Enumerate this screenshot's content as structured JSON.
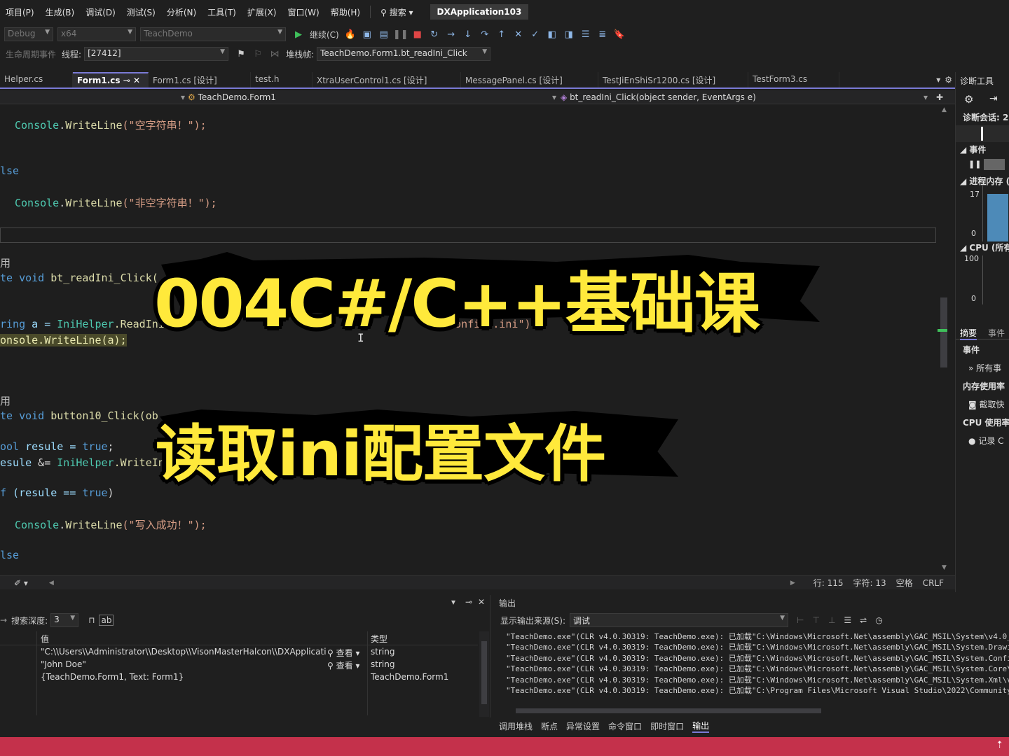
{
  "menu": [
    "项目(P)",
    "生成(B)",
    "调试(D)",
    "测试(S)",
    "分析(N)",
    "工具(T)",
    "扩展(X)",
    "窗口(W)",
    "帮助(H)"
  ],
  "search_label": "搜索",
  "app_title": "DXApplication103",
  "toolbar": {
    "config": "Debug",
    "platform": "x64",
    "project": "TeachDemo",
    "continue_label": "继续(C)",
    "lifecycle_label": "生命周期事件",
    "thread_label": "线程:",
    "thread_value": "[27412]",
    "stack_label": "堆栈帧:",
    "stack_value": "TeachDemo.Form1.bt_readIni_Click"
  },
  "tabs": [
    "Helper.cs",
    "Form1.cs",
    "Form1.cs [设计]",
    "test.h",
    "XtraUserControl1.cs [设计]",
    "MessagePanel.cs [设计]",
    "TestJiEnShiSr1200.cs [设计]",
    "TestForm3.cs"
  ],
  "nav": {
    "class": "TeachDemo.Form1",
    "member": "bt_readIni_Click(object sender, EventArgs e)"
  },
  "code": {
    "l1_obj": "Console",
    "l1_fn": "WriteLine",
    "l1_str": "(\"空字符串！\");",
    "l2": "lse",
    "l3_obj": "Console",
    "l3_fn": "WriteLine",
    "l3_str": "(\"非空字符串！\");",
    "l4": "用",
    "l5_kw": "te void",
    "l5_fn": "bt_readIni_Click(",
    "l6_kw": "ring",
    "l6_id": " a = ",
    "l6_ty": "IniHelper",
    "l6_rest": ".ReadIni",
    "l6_tail": "+ \"\\config2.ini\");",
    "l7": "onsole.WriteLine(a);",
    "l8": "用",
    "l9_kw": "te void",
    "l9_fn": "button10_Click(ob",
    "l10_kw": "ool",
    "l10_rest": " resule = ",
    "l10_val": "true",
    "l11_id": "esule",
    "l11_op": " &= ",
    "l11_ty": "IniHelper",
    "l11_rest": ".WriteIn",
    "l12_kw": "f",
    "l12_rest": " (resule == ",
    "l12_val": "true",
    "l13_obj": "Console",
    "l13_fn": "WriteLine",
    "l13_str": "(\"写入成功！\");",
    "l14": "lse"
  },
  "editor_status": {
    "line": "行: 115",
    "char": "字符: 13",
    "space": "空格",
    "eol": "CRLF"
  },
  "diag": {
    "title": "诊断工具",
    "session": "诊断会话: 2",
    "events": "事件",
    "process_mem": "进程内存 (",
    "mem_max": "17",
    "mem_min": "0",
    "cpu": "CPU (所有",
    "cpu_max": "100",
    "cpu_min": "0",
    "tab_summary": "摘要",
    "tab_events": "事件",
    "h_events": "事件",
    "all_events": "所有事",
    "mem_usage": "内存使用率",
    "snapshot": "截取快",
    "cpu_usage": "CPU 使用率",
    "record": "记录 C"
  },
  "locals": {
    "depth_label": "搜索深度:",
    "depth_value": "3",
    "col_value": "值",
    "col_type": "类型",
    "view": "查看",
    "rows": [
      {
        "value": "\"C:\\\\Users\\\\Administrator\\\\Desktop\\\\VisonMasterHalcon\\\\DXApplicatio...",
        "type": "string"
      },
      {
        "value": "\"John Doe\"",
        "type": "string"
      },
      {
        "value": "{TeachDemo.Form1, Text: Form1}",
        "type": "TeachDemo.Form1"
      }
    ]
  },
  "output": {
    "title": "输出",
    "source_label": "显示输出来源(S):",
    "source_value": "调试",
    "lines": [
      "\"TeachDemo.exe\"(CLR v4.0.30319: TeachDemo.exe): 已加载\"C:\\Windows\\Microsoft.Net\\assembly\\GAC_MSIL\\System\\v4.0_4.0",
      "\"TeachDemo.exe\"(CLR v4.0.30319: TeachDemo.exe): 已加载\"C:\\Windows\\Microsoft.Net\\assembly\\GAC_MSIL\\System.Drawing",
      "\"TeachDemo.exe\"(CLR v4.0.30319: TeachDemo.exe): 已加载\"C:\\Windows\\Microsoft.Net\\assembly\\GAC_MSIL\\System.Configur",
      "\"TeachDemo.exe\"(CLR v4.0.30319: TeachDemo.exe): 已加载\"C:\\Windows\\Microsoft.Net\\assembly\\GAC_MSIL\\System.Core\\v4.",
      "\"TeachDemo.exe\"(CLR v4.0.30319: TeachDemo.exe): 已加载\"C:\\Windows\\Microsoft.Net\\assembly\\GAC_MSIL\\System.Xml\\v4.0",
      "\"TeachDemo.exe\"(CLR v4.0.30319: TeachDemo.exe): 已加载\"C:\\Program Files\\Microsoft Visual Studio\\2022\\Community\\Co"
    ]
  },
  "bottom_tabs": [
    "调用堆栈",
    "断点",
    "异常设置",
    "命令窗口",
    "即时窗口",
    "输出"
  ],
  "overlay": {
    "line1": "004C#/C++基础课",
    "line2": "读取ini配置文件"
  }
}
